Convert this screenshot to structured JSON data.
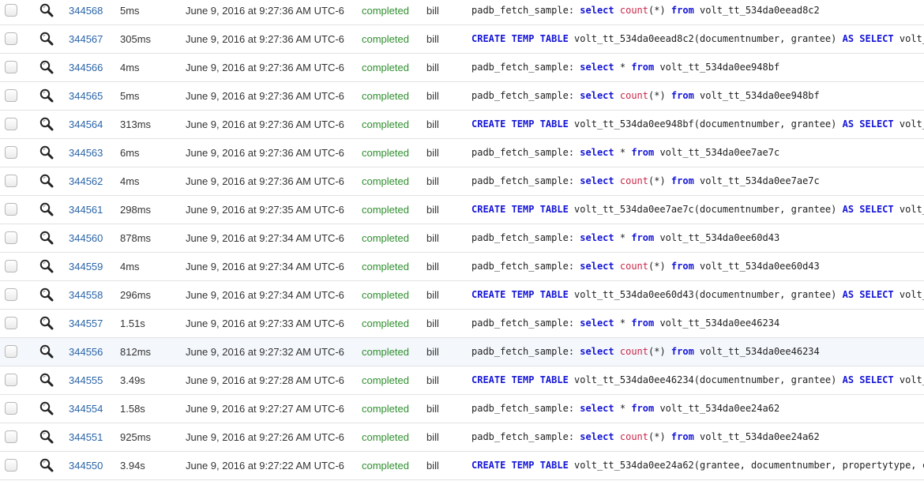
{
  "colors": {
    "id_link": "#2a64a8",
    "status_completed": "#2f8f2f",
    "sql_keyword": "#1515d6",
    "sql_function": "#c8284a"
  },
  "icons": {
    "row_select": "checkbox",
    "row_view": "magnifier-icon"
  },
  "rows": [
    {
      "id": "344568",
      "duration": "5ms",
      "time": "June 9, 2016 at 9:27:36 AM UTC-6",
      "status": "completed",
      "user": "bill",
      "sql": [
        [
          "padb_fetch_sample: ",
          ""
        ],
        [
          "select",
          "kw"
        ],
        [
          " ",
          ""
        ],
        [
          "count",
          "fn"
        ],
        [
          "(*) ",
          ""
        ],
        [
          "from",
          "kw"
        ],
        [
          " volt_tt_534da0eead8c2",
          ""
        ]
      ]
    },
    {
      "id": "344567",
      "duration": "305ms",
      "time": "June 9, 2016 at 9:27:36 AM UTC-6",
      "status": "completed",
      "user": "bill",
      "sql": [
        [
          "CREATE TEMP TABLE",
          "kw"
        ],
        [
          " volt_tt_534da0eead8c2(documentnumber, grantee) ",
          ""
        ],
        [
          "AS SELECT",
          "kw"
        ],
        [
          " volt_",
          ""
        ]
      ]
    },
    {
      "id": "344566",
      "duration": "4ms",
      "time": "June 9, 2016 at 9:27:36 AM UTC-6",
      "status": "completed",
      "user": "bill",
      "sql": [
        [
          "padb_fetch_sample: ",
          ""
        ],
        [
          "select",
          "kw"
        ],
        [
          " * ",
          ""
        ],
        [
          "from",
          "kw"
        ],
        [
          " volt_tt_534da0ee948bf",
          ""
        ]
      ]
    },
    {
      "id": "344565",
      "duration": "5ms",
      "time": "June 9, 2016 at 9:27:36 AM UTC-6",
      "status": "completed",
      "user": "bill",
      "sql": [
        [
          "padb_fetch_sample: ",
          ""
        ],
        [
          "select",
          "kw"
        ],
        [
          " ",
          ""
        ],
        [
          "count",
          "fn"
        ],
        [
          "(*) ",
          ""
        ],
        [
          "from",
          "kw"
        ],
        [
          " volt_tt_534da0ee948bf",
          ""
        ]
      ]
    },
    {
      "id": "344564",
      "duration": "313ms",
      "time": "June 9, 2016 at 9:27:36 AM UTC-6",
      "status": "completed",
      "user": "bill",
      "sql": [
        [
          "CREATE TEMP TABLE",
          "kw"
        ],
        [
          " volt_tt_534da0ee948bf(documentnumber, grantee) ",
          ""
        ],
        [
          "AS SELECT",
          "kw"
        ],
        [
          " volt_",
          ""
        ]
      ]
    },
    {
      "id": "344563",
      "duration": "6ms",
      "time": "June 9, 2016 at 9:27:36 AM UTC-6",
      "status": "completed",
      "user": "bill",
      "sql": [
        [
          "padb_fetch_sample: ",
          ""
        ],
        [
          "select",
          "kw"
        ],
        [
          " * ",
          ""
        ],
        [
          "from",
          "kw"
        ],
        [
          " volt_tt_534da0ee7ae7c",
          ""
        ]
      ]
    },
    {
      "id": "344562",
      "duration": "4ms",
      "time": "June 9, 2016 at 9:27:36 AM UTC-6",
      "status": "completed",
      "user": "bill",
      "sql": [
        [
          "padb_fetch_sample: ",
          ""
        ],
        [
          "select",
          "kw"
        ],
        [
          " ",
          ""
        ],
        [
          "count",
          "fn"
        ],
        [
          "(*) ",
          ""
        ],
        [
          "from",
          "kw"
        ],
        [
          " volt_tt_534da0ee7ae7c",
          ""
        ]
      ]
    },
    {
      "id": "344561",
      "duration": "298ms",
      "time": "June 9, 2016 at 9:27:35 AM UTC-6",
      "status": "completed",
      "user": "bill",
      "sql": [
        [
          "CREATE TEMP TABLE",
          "kw"
        ],
        [
          " volt_tt_534da0ee7ae7c(documentnumber, grantee) ",
          ""
        ],
        [
          "AS SELECT",
          "kw"
        ],
        [
          " volt_",
          ""
        ]
      ]
    },
    {
      "id": "344560",
      "duration": "878ms",
      "time": "June 9, 2016 at 9:27:34 AM UTC-6",
      "status": "completed",
      "user": "bill",
      "sql": [
        [
          "padb_fetch_sample: ",
          ""
        ],
        [
          "select",
          "kw"
        ],
        [
          " * ",
          ""
        ],
        [
          "from",
          "kw"
        ],
        [
          " volt_tt_534da0ee60d43",
          ""
        ]
      ]
    },
    {
      "id": "344559",
      "duration": "4ms",
      "time": "June 9, 2016 at 9:27:34 AM UTC-6",
      "status": "completed",
      "user": "bill",
      "sql": [
        [
          "padb_fetch_sample: ",
          ""
        ],
        [
          "select",
          "kw"
        ],
        [
          " ",
          ""
        ],
        [
          "count",
          "fn"
        ],
        [
          "(*) ",
          ""
        ],
        [
          "from",
          "kw"
        ],
        [
          " volt_tt_534da0ee60d43",
          ""
        ]
      ]
    },
    {
      "id": "344558",
      "duration": "296ms",
      "time": "June 9, 2016 at 9:27:34 AM UTC-6",
      "status": "completed",
      "user": "bill",
      "sql": [
        [
          "CREATE TEMP TABLE",
          "kw"
        ],
        [
          " volt_tt_534da0ee60d43(documentnumber, grantee) ",
          ""
        ],
        [
          "AS SELECT",
          "kw"
        ],
        [
          " volt_",
          ""
        ]
      ]
    },
    {
      "id": "344557",
      "duration": "1.51s",
      "time": "June 9, 2016 at 9:27:33 AM UTC-6",
      "status": "completed",
      "user": "bill",
      "sql": [
        [
          "padb_fetch_sample: ",
          ""
        ],
        [
          "select",
          "kw"
        ],
        [
          " * ",
          ""
        ],
        [
          "from",
          "kw"
        ],
        [
          " volt_tt_534da0ee46234",
          ""
        ]
      ]
    },
    {
      "id": "344556",
      "duration": "812ms",
      "time": "June 9, 2016 at 9:27:32 AM UTC-6",
      "status": "completed",
      "user": "bill",
      "highlighted": true,
      "sql": [
        [
          "padb_fetch_sample: ",
          ""
        ],
        [
          "select",
          "kw"
        ],
        [
          " ",
          ""
        ],
        [
          "count",
          "fn"
        ],
        [
          "(*) ",
          ""
        ],
        [
          "from",
          "kw"
        ],
        [
          " volt_tt_534da0ee46234",
          ""
        ]
      ]
    },
    {
      "id": "344555",
      "duration": "3.49s",
      "time": "June 9, 2016 at 9:27:28 AM UTC-6",
      "status": "completed",
      "user": "bill",
      "sql": [
        [
          "CREATE TEMP TABLE",
          "kw"
        ],
        [
          " volt_tt_534da0ee46234(documentnumber, grantee) ",
          ""
        ],
        [
          "AS SELECT",
          "kw"
        ],
        [
          " volt_",
          ""
        ]
      ]
    },
    {
      "id": "344554",
      "duration": "1.58s",
      "time": "June 9, 2016 at 9:27:27 AM UTC-6",
      "status": "completed",
      "user": "bill",
      "sql": [
        [
          "padb_fetch_sample: ",
          ""
        ],
        [
          "select",
          "kw"
        ],
        [
          " * ",
          ""
        ],
        [
          "from",
          "kw"
        ],
        [
          " volt_tt_534da0ee24a62",
          ""
        ]
      ]
    },
    {
      "id": "344551",
      "duration": "925ms",
      "time": "June 9, 2016 at 9:27:26 AM UTC-6",
      "status": "completed",
      "user": "bill",
      "sql": [
        [
          "padb_fetch_sample: ",
          ""
        ],
        [
          "select",
          "kw"
        ],
        [
          " ",
          ""
        ],
        [
          "count",
          "fn"
        ],
        [
          "(*) ",
          ""
        ],
        [
          "from",
          "kw"
        ],
        [
          " volt_tt_534da0ee24a62",
          ""
        ]
      ]
    },
    {
      "id": "344550",
      "duration": "3.94s",
      "time": "June 9, 2016 at 9:27:22 AM UTC-6",
      "status": "completed",
      "user": "bill",
      "sql": [
        [
          "CREATE TEMP TABLE",
          "kw"
        ],
        [
          " volt_tt_534da0ee24a62(grantee, documentnumber, propertytype, c",
          ""
        ]
      ]
    }
  ]
}
